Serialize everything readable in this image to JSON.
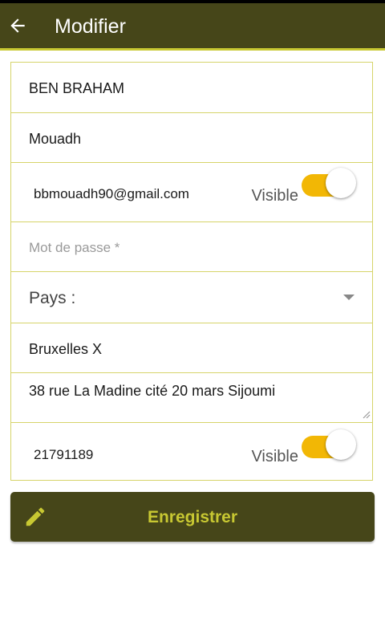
{
  "header": {
    "title": "Modifier",
    "back_icon": "arrow-left-icon"
  },
  "form": {
    "last_name": "BEN BRAHAM",
    "first_name": "Mouadh",
    "email": "bbmouadh90@gmail.com",
    "email_visibility": {
      "label": "Visible",
      "on": true
    },
    "password_placeholder": "Mot de passe *",
    "country_label": "Pays :",
    "city": "Bruxelles X",
    "address": "38 rue La Madine cité 20 mars Sijoumi",
    "phone": "21791189",
    "phone_visibility": {
      "label": "Visible",
      "on": true
    }
  },
  "save_button": {
    "label": "Enregistrer",
    "icon": "pencil-icon"
  },
  "colors": {
    "appbar": "#464619",
    "accent": "#c8c832",
    "toggle_on": "#f2b705",
    "border": "#d6d46a"
  }
}
